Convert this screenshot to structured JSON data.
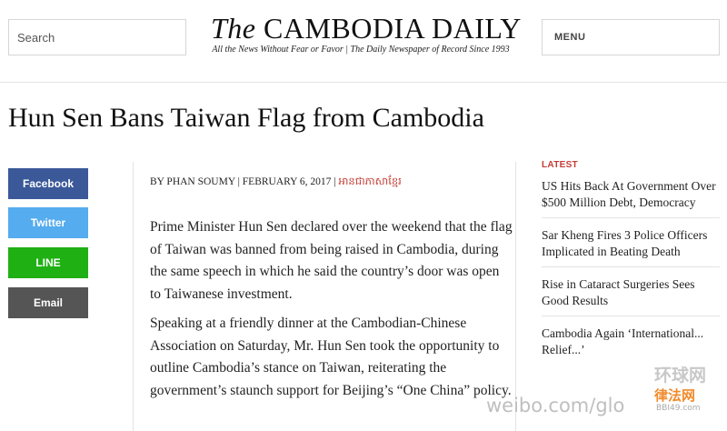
{
  "header": {
    "search_placeholder": "Search",
    "logo_the": "The",
    "logo_name": "CAMBODIA DAILY",
    "logo_tagline": "All the News Without Fear or Favor | The Daily Newspaper of Record Since 1993",
    "menu_label": "MENU"
  },
  "article": {
    "title": "Hun Sen Bans Taiwan Flag from Cambodia",
    "byline": "BY PHAN SOUMY | FEBRUARY 6, 2017 |",
    "byline_khmer": "អានជាភាសាខ្មែរ",
    "paragraphs": [
      "Prime Minister Hun Sen declared over the weekend that the flag of Taiwan was banned from being raised in Cambodia, during the same speech in which he said the country’s door was open to Taiwanese investment.",
      "Speaking at a friendly dinner at the Cambodian-Chinese Association on Saturday, Mr. Hun Sen took the opportunity to outline Cambodia’s stance on Taiwan, reiterating the government’s staunch support for Beijing’s “One China” policy."
    ]
  },
  "share": {
    "facebook": "Facebook",
    "twitter": "Twitter",
    "line": "LINE",
    "email": "Email"
  },
  "sidebar": {
    "heading": "LATEST",
    "items": [
      "US Hits Back At Government Over $500 Million Debt, Democracy",
      "Sar Kheng Fires 3 Police Officers Implicated in Beating Death",
      "Rise in Cataract Surgeries Sees Good Results",
      "Cambodia Again ‘International... Relief...’"
    ]
  },
  "watermark": {
    "text": "weibo.com/glo",
    "brand1": "环球网",
    "brand2": "律法网",
    "brand3": "BBI49.com"
  },
  "colors": {
    "facebook": "#3b5998",
    "twitter": "#55acee",
    "line": "#1fb013",
    "email": "#555555",
    "accent": "#c43b34"
  }
}
